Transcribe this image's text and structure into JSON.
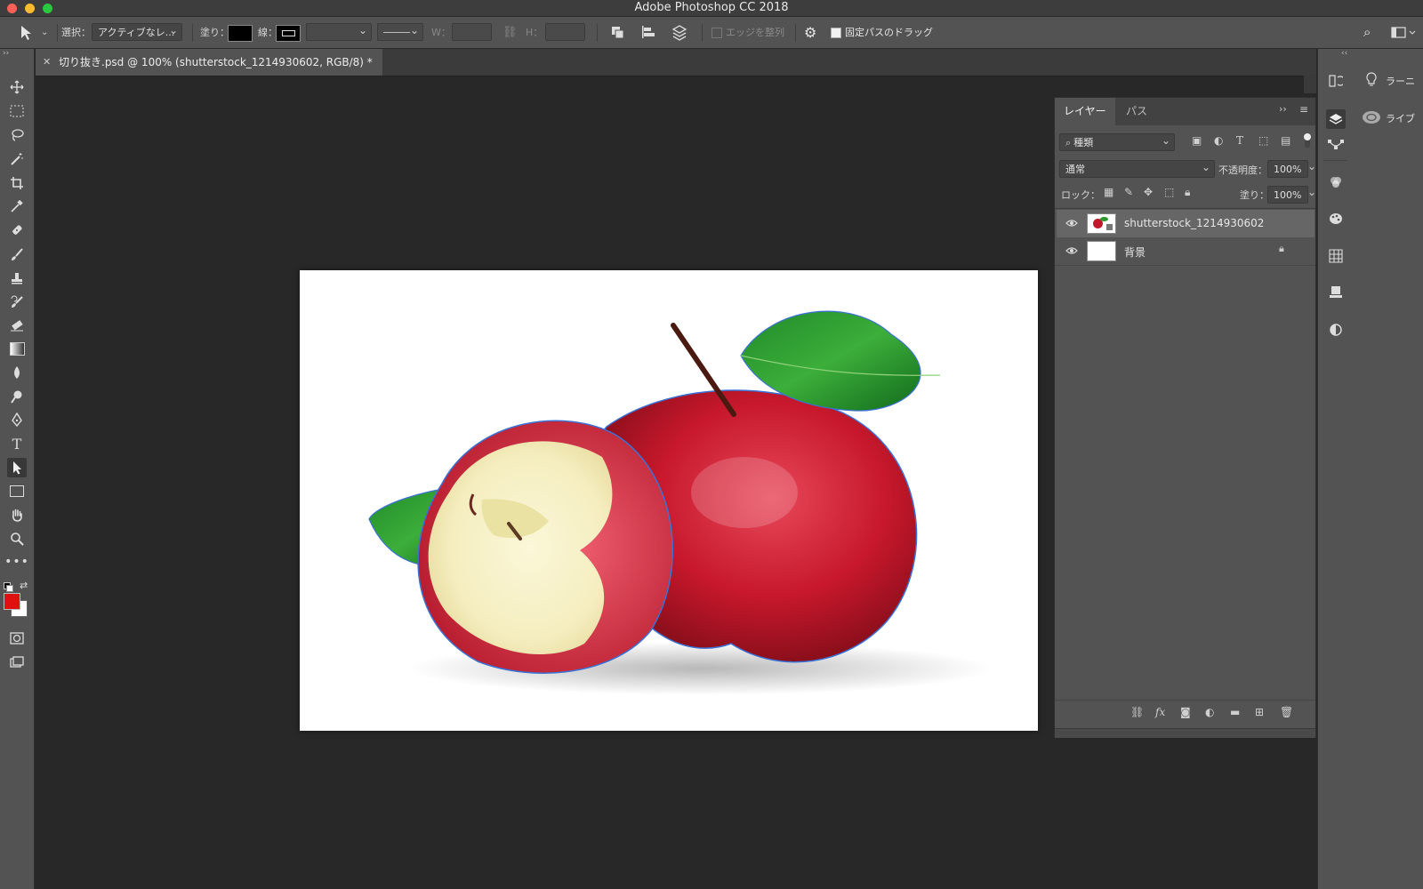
{
  "window": {
    "title": "Adobe Photoshop CC 2018"
  },
  "options_bar": {
    "select_label": "選択：",
    "select_value": "アクティブなレ...",
    "fill_label": "塗り：",
    "stroke_label": "線：",
    "w_label": "W：",
    "h_label": "H：",
    "align_edges_label": "エッジを整列",
    "constrain_path_label": "固定パスのドラッグ"
  },
  "document": {
    "tab_title": "切り抜き.psd @ 100% (shutterstock_1214930602, RGB/8) *"
  },
  "tools": [
    "move-tool",
    "marquee-tool",
    "lasso-tool",
    "magic-wand-tool",
    "crop-tool",
    "eyedropper-tool",
    "healing-tool",
    "brush-tool",
    "stamp-tool",
    "history-brush-tool",
    "eraser-tool",
    "gradient-tool",
    "blur-tool",
    "dodge-tool",
    "pen-tool",
    "type-tool",
    "path-selection-tool",
    "rectangle-tool",
    "hand-tool",
    "zoom-tool",
    "more-tools"
  ],
  "colors": {
    "foreground": "#e01010",
    "background": "#ffffff",
    "path_outline": "#3a72d6"
  },
  "layers_panel": {
    "tabs": [
      "レイヤー",
      "パス"
    ],
    "filter_kind": "種類",
    "blend_mode": "通常",
    "opacity_label": "不透明度：",
    "opacity_value": "100%",
    "lock_label": "ロック：",
    "fill_label": "塗り：",
    "fill_value": "100%",
    "layers": [
      {
        "name": "shutterstock_1214930602",
        "visible": true,
        "selected": true
      },
      {
        "name": "背景",
        "visible": true,
        "locked": true
      }
    ]
  },
  "right_panel": {
    "learn_label": "ラーニ",
    "libraries_label": "ライブ"
  }
}
